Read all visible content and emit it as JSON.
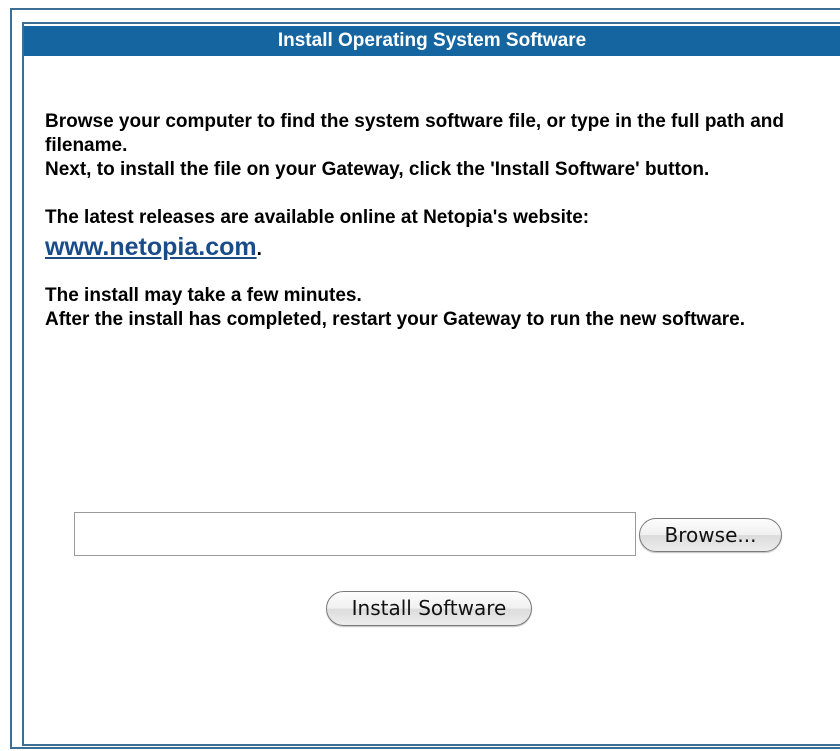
{
  "header": {
    "title": "Install Operating System Software"
  },
  "instructions": {
    "line1": "Browse your computer to find the system software file, or type in the full path and filename.",
    "line2": "Next, to install the file on your Gateway, click the 'Install Software' button.",
    "releases_text": "The latest releases are available online at Netopia's website:",
    "link_text": "www.netopia.com",
    "link_suffix": ".",
    "install_note1": "The install may take a few minutes.",
    "install_note2": "After the install has completed, restart your Gateway to run the new software."
  },
  "file_upload": {
    "value": "",
    "browse_label": "Browse..."
  },
  "actions": {
    "install_label": "Install Software"
  },
  "colors": {
    "header_bg": "#1565a1",
    "frame": "#3d6f96",
    "link": "#1a4c8a"
  }
}
